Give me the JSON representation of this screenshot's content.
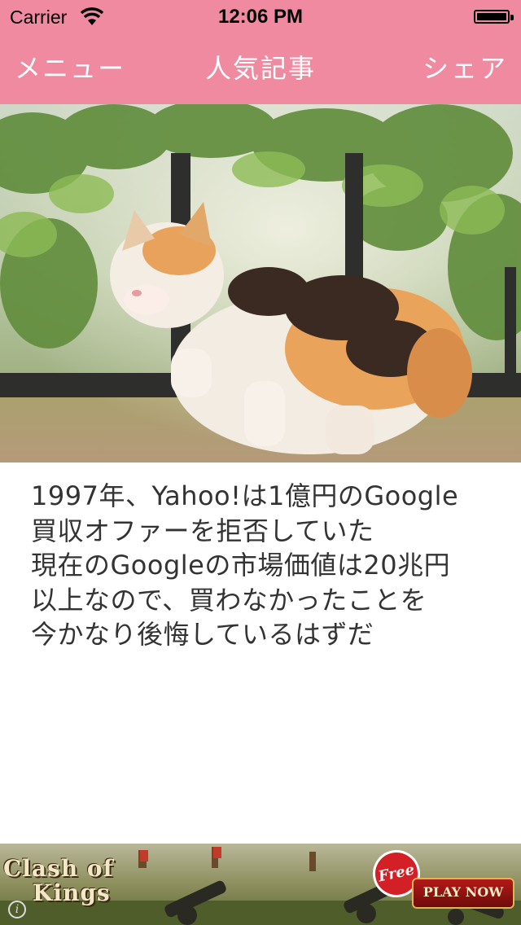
{
  "status_bar": {
    "carrier": "Carrier",
    "time": "12:06 PM"
  },
  "nav": {
    "menu_label": "メニュー",
    "title": "人気記事",
    "share_label": "シェア"
  },
  "hero_image": {
    "subject": "calico kitten on a fence"
  },
  "article": {
    "text": "1997年、Yahoo!は1億円のGoogle\n買収オファーを拒否していた\n現在のGoogleの市場価値は20兆円\n以上なので、買わなかったことを\n今かなり後悔しているはずだ"
  },
  "ad": {
    "logo_line1": "Clash of",
    "logo_line2": "Kings",
    "free_badge": "Free",
    "play_button": "PLAY NOW",
    "info_icon": "i"
  },
  "colors": {
    "nav_background": "#f08aa1",
    "nav_text": "#ffffff",
    "article_text": "#333333"
  }
}
